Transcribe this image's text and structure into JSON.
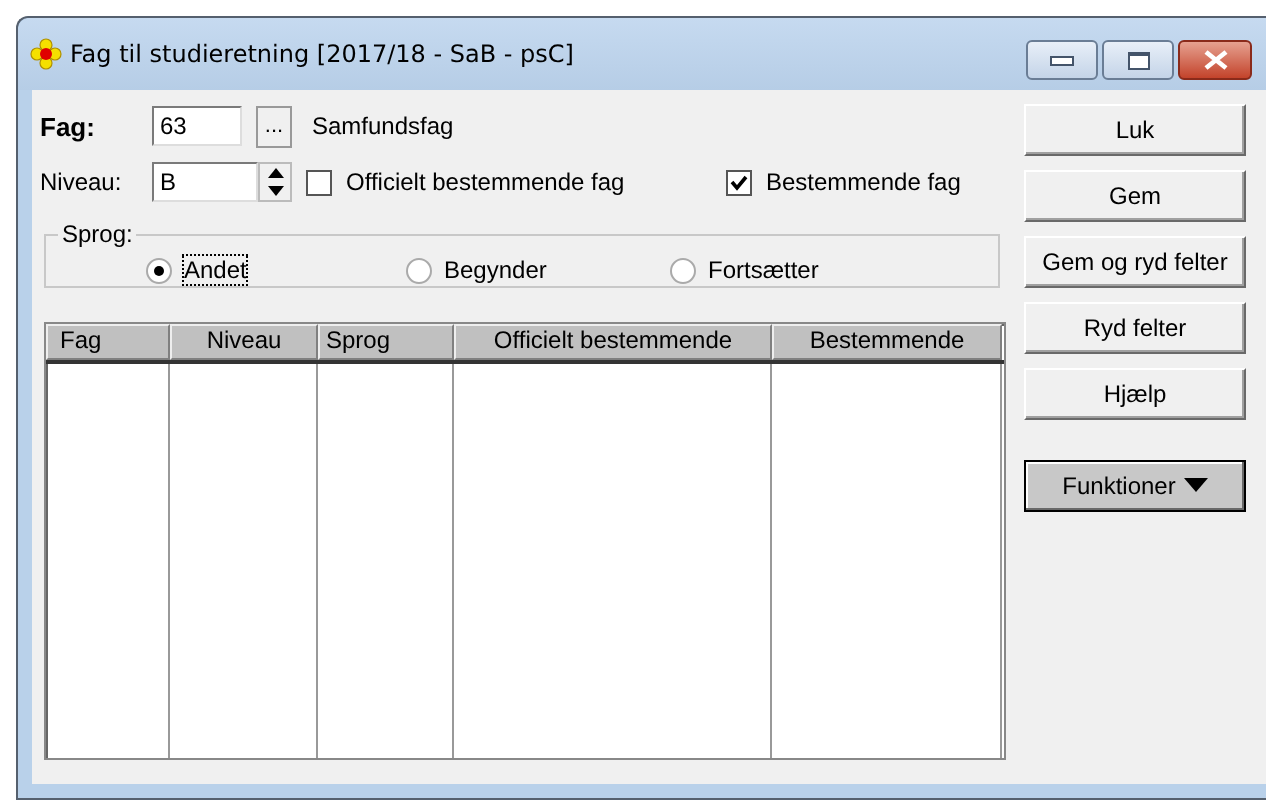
{
  "window": {
    "title": "Fag til studieretning [2017/18 - SaB - psC]"
  },
  "fag": {
    "label": "Fag:",
    "value": "63",
    "browse": "...",
    "name": "Samfundsfag"
  },
  "niveau": {
    "label": "Niveau:",
    "value": "B"
  },
  "checkboxes": [
    {
      "label": "Officielt bestemmende fag",
      "checked": false
    },
    {
      "label": "Bestemmende fag",
      "checked": true
    }
  ],
  "sprog": {
    "label": "Sprog:",
    "options": [
      {
        "label": "Andet",
        "selected": true
      },
      {
        "label": "Begynder",
        "selected": false
      },
      {
        "label": "Fortsætter",
        "selected": false
      }
    ]
  },
  "table": {
    "columns": [
      "Fag",
      "Niveau",
      "Sprog",
      "Officielt bestemmende",
      "Bestemmende"
    ]
  },
  "buttons": [
    {
      "label": "Luk",
      "kind": "plain"
    },
    {
      "label": "Gem",
      "kind": "plain"
    },
    {
      "label": "Gem og ryd felter",
      "kind": "plain"
    },
    {
      "label": "Ryd felter",
      "kind": "plain"
    },
    {
      "label": "Hjælp",
      "kind": "plain"
    },
    {
      "label": "Funktioner",
      "kind": "menu"
    }
  ]
}
